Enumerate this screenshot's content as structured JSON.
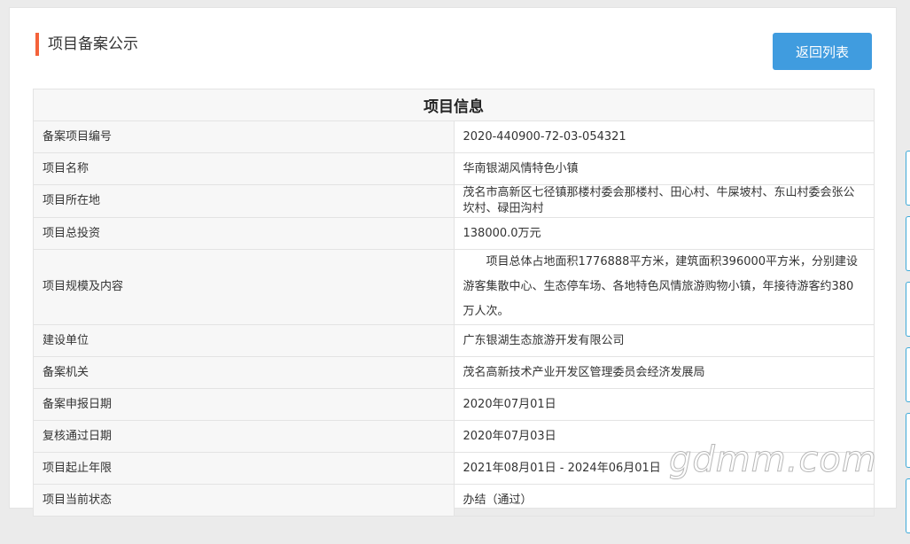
{
  "colors": {
    "accent_bar": "#f4623a",
    "button_bg": "#409cdf",
    "side_tab_border": "#3da9d8"
  },
  "header": {
    "section_title": "项目备案公示",
    "back_button_label": "返回列表"
  },
  "table": {
    "title": "项目信息",
    "rows": [
      {
        "label": "备案项目编号",
        "value": "2020-440900-72-03-054321"
      },
      {
        "label": "项目名称",
        "value": "华南银湖风情特色小镇"
      },
      {
        "label": "项目所在地",
        "value": "茂名市高新区七径镇那楼村委会那楼村、田心村、牛屎坡村、东山村委会张公坎村、碌田沟村"
      },
      {
        "label": "项目总投资",
        "value": "138000.0万元"
      },
      {
        "label": "项目规模及内容",
        "value": "项目总体占地面积1776888平方米，建筑面积396000平方米，分别建设游客集散中心、生态停车场、各地特色风情旅游购物小镇，年接待游客约380万人次。"
      },
      {
        "label": "建设单位",
        "value": "广东银湖生态旅游开发有限公司"
      },
      {
        "label": "备案机关",
        "value": "茂名高新技术产业开发区管理委员会经济发展局"
      },
      {
        "label": "备案申报日期",
        "value": "2020年07月01日"
      },
      {
        "label": "复核通过日期",
        "value": "2020年07月03日"
      },
      {
        "label": "项目起止年限",
        "value": "2021年08月01日 - 2024年06月01日"
      },
      {
        "label": "项目当前状态",
        "value": "办结（通过）"
      }
    ]
  },
  "watermark": "gdmm.com"
}
